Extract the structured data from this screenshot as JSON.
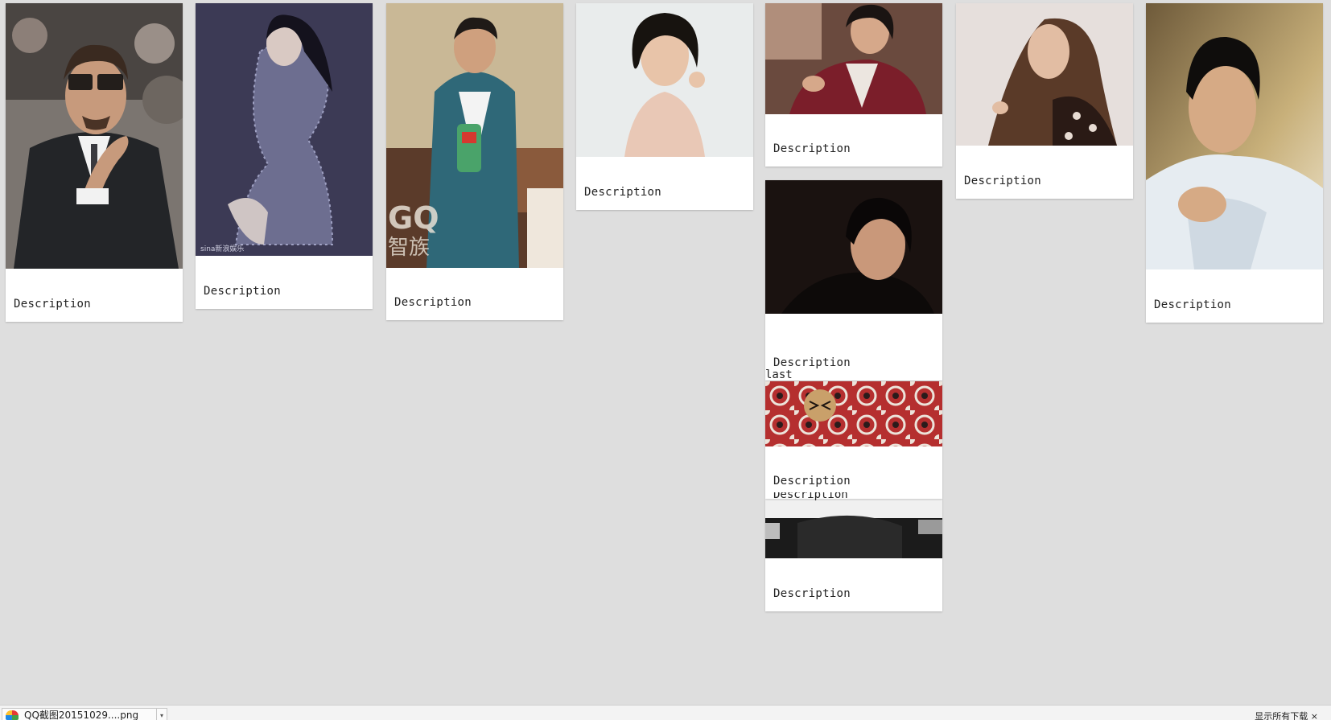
{
  "gallery": {
    "cards": [
      {
        "caption": "Description",
        "subject": "man in black suit and glasses pointing"
      },
      {
        "caption": "Description",
        "subject": "woman in lace dress on purple background"
      },
      {
        "caption": "Description",
        "subject": "man in teal coat holding snack bag"
      },
      {
        "caption": "Description",
        "subject": "woman with short black hair"
      },
      {
        "caption": "Description",
        "subject": "man in red jacket"
      },
      {
        "caption": "Description",
        "subject": "woman with long wavy hair"
      },
      {
        "caption": "Description",
        "subject": "man in white shirt reaching forward"
      },
      {
        "caption": "Description",
        "subject": "man in black on dark background"
      },
      {
        "caption": "Description",
        "subject": "red patterned fabric with tiger head"
      },
      {
        "caption": "Description",
        "subject": "dark partial image"
      }
    ],
    "overlap_caption": "Description",
    "last_label": "last",
    "watermarks": {
      "sina": "sina新浪娱乐",
      "gq": "GQ",
      "gq_chinese": "智族"
    }
  },
  "download_bar": {
    "filename": "QQ截图20151029....png",
    "icon": "qq-screenshot-file-icon",
    "right_text": "显示所有下载 ×"
  }
}
